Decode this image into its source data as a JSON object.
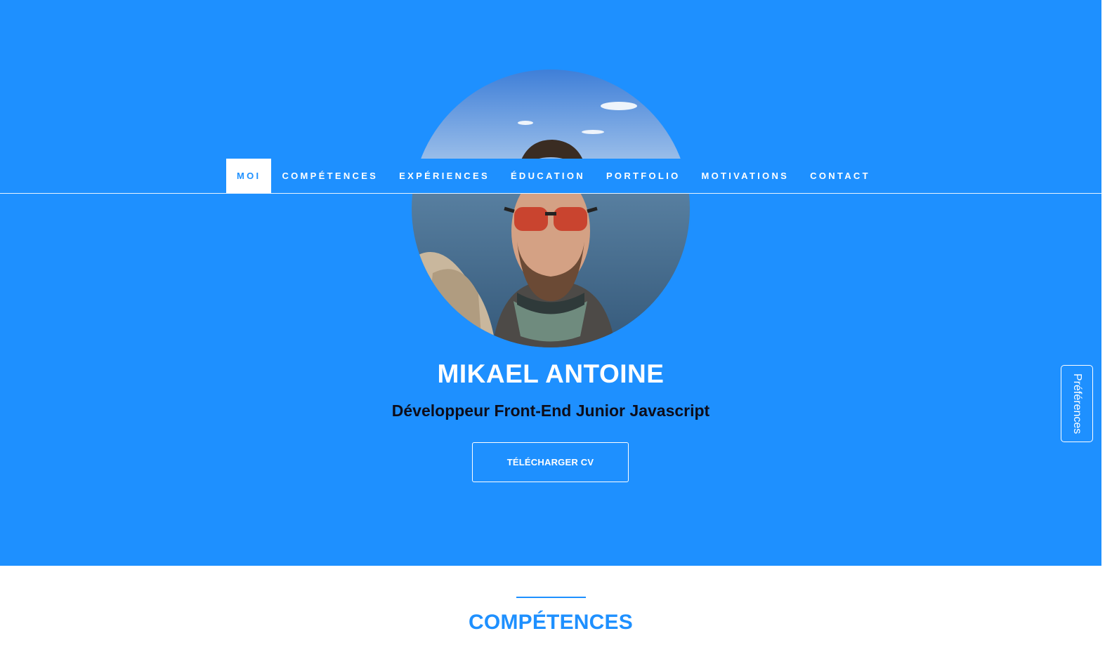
{
  "nav": {
    "items": [
      {
        "label": "MOI",
        "active": true
      },
      {
        "label": "COMPÉTENCES",
        "active": false
      },
      {
        "label": "EXPÉRIENCES",
        "active": false
      },
      {
        "label": "ÉDUCATION",
        "active": false
      },
      {
        "label": "PORTFOLIO",
        "active": false
      },
      {
        "label": "MOTIVATIONS",
        "active": false
      },
      {
        "label": "CONTACT",
        "active": false
      }
    ]
  },
  "hero": {
    "name": "MIKAEL ANTOINE",
    "subtitle": "Développeur Front-End Junior Javascript",
    "cv_button": "TÉLÉCHARGER CV",
    "avatar_icon": "profile-photo"
  },
  "preferences": {
    "label": "Préférences"
  },
  "section": {
    "title": "COMPÉTENCES"
  },
  "colors": {
    "primary": "#1e90ff",
    "white": "#ffffff",
    "dark_text": "#0d0d1a"
  }
}
